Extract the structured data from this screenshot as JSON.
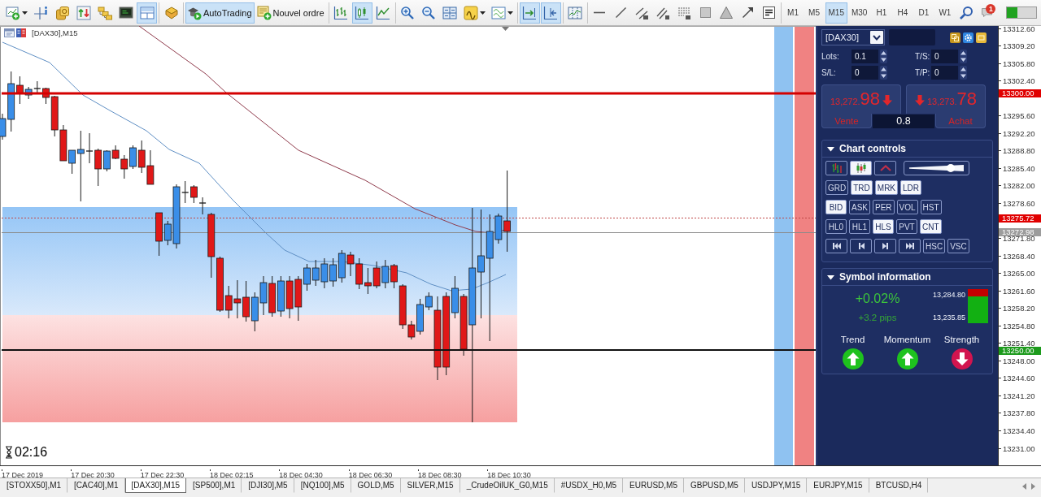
{
  "toolbar": {
    "groups": [
      [
        {
          "kind": "newchart",
          "selected": false,
          "dropdown": true
        },
        {
          "kind": "crosshair",
          "selected": false
        },
        {
          "kind": "market",
          "selected": false
        },
        {
          "kind": "datawindow",
          "selected": false
        },
        {
          "kind": "navigator",
          "selected": false
        },
        {
          "kind": "terminal",
          "selected": false
        },
        {
          "kind": "tester",
          "selected": true
        }
      ],
      [
        {
          "kind": "editor",
          "selected": false
        }
      ],
      [
        {
          "kind": "autotrading",
          "label": "AutoTrading",
          "selected": true
        },
        {
          "kind": "neworder",
          "label": "Nouvel ordre",
          "selected": false
        }
      ],
      [
        {
          "kind": "barchart",
          "selected": false
        },
        {
          "kind": "candles",
          "selected": true
        },
        {
          "kind": "linechart",
          "selected": false
        }
      ],
      [
        {
          "kind": "zoomin",
          "selected": false
        },
        {
          "kind": "zoomout",
          "selected": false
        },
        {
          "kind": "tile",
          "selected": false
        },
        {
          "kind": "indicators",
          "selected": false,
          "dropdown": true
        },
        {
          "kind": "templates",
          "selected": false,
          "dropdown": true
        }
      ],
      [
        {
          "kind": "autoscroll",
          "selected": true
        },
        {
          "kind": "chartshift",
          "selected": true
        }
      ],
      [
        {
          "kind": "periods",
          "selected": false
        }
      ],
      [
        {
          "kind": "hline",
          "selected": false
        },
        {
          "kind": "trendline",
          "selected": false
        },
        {
          "kind": "channel",
          "selected": false
        },
        {
          "kind": "fibo",
          "selected": false
        },
        {
          "kind": "fibogrid",
          "selected": false
        },
        {
          "kind": "rectangle",
          "selected": false
        },
        {
          "kind": "triangle",
          "selected": false
        },
        {
          "kind": "arrow",
          "selected": false
        },
        {
          "kind": "text",
          "selected": false
        }
      ],
      [
        {
          "kind": "period",
          "label": "M1",
          "selected": false
        },
        {
          "kind": "period",
          "label": "M5",
          "selected": false
        },
        {
          "kind": "period",
          "label": "M15",
          "selected": true
        },
        {
          "kind": "period",
          "label": "M30",
          "selected": false
        },
        {
          "kind": "period",
          "label": "H1",
          "selected": false
        },
        {
          "kind": "period",
          "label": "H4",
          "selected": false
        },
        {
          "kind": "period",
          "label": "D1",
          "selected": false
        },
        {
          "kind": "period",
          "label": "W1",
          "selected": false
        },
        {
          "kind": "search",
          "selected": false
        },
        {
          "kind": "alerts",
          "selected": false,
          "badge": "1"
        },
        {
          "kind": "connection"
        }
      ]
    ]
  },
  "chart": {
    "title": "[DAX30],M15",
    "timer": "02:16",
    "price_axis": [
      "13312.60",
      "13309.20",
      "13305.80",
      "13302.40",
      "13295.60",
      "13292.20",
      "13288.80",
      "13285.40",
      "13282.00",
      "13278.60",
      "13271.80",
      "13268.40",
      "13265.00",
      "13261.60",
      "13258.20",
      "13254.80",
      "13251.40",
      "13248.00",
      "13244.60",
      "13241.20",
      "13237.80",
      "13234.40",
      "13231.00"
    ],
    "price_tags": [
      {
        "value": "13300.00",
        "color": "#e00000"
      },
      {
        "value": "13275.72",
        "color": "#e00000"
      },
      {
        "value": "13272.98",
        "color": "#9c9c9c"
      },
      {
        "value": "13250.00",
        "color": "#1c9a1c"
      }
    ],
    "time_axis": [
      "17 Dec 2019",
      "17 Dec 20:30",
      "17 Dec 22:30",
      "18 Dec 02:15",
      "18 Dec 04:30",
      "18 Dec 06:30",
      "18 Dec 08:30",
      "18 Dec 10:30"
    ]
  },
  "panel": {
    "symbol": "[DAX30]",
    "fields": [
      {
        "label": "Lots:",
        "value": "0.1"
      },
      {
        "label": "T/S:",
        "value": "0"
      },
      {
        "label": "S/L:",
        "value": "0"
      },
      {
        "label": "T/P:",
        "value": "0"
      }
    ],
    "sell": {
      "price_main": "13,272.",
      "price_pips": "98",
      "rising": false,
      "label": "Vente"
    },
    "spread": "0.8",
    "buy": {
      "price_main": "13,273.",
      "price_pips": "78",
      "rising": false,
      "label": "Achat"
    },
    "chart_controls": {
      "title": "Chart controls",
      "expanded": true,
      "chart_types": [
        {
          "kind": "bars",
          "selected": false
        },
        {
          "kind": "candles",
          "selected": true
        },
        {
          "kind": "line",
          "selected": false
        }
      ],
      "zoom": {
        "level": 0.76
      },
      "rows": [
        [
          {
            "kind": "label",
            "label": "GRD",
            "selected": false
          },
          {
            "kind": "label",
            "label": "TRD",
            "selected": true
          },
          {
            "kind": "label",
            "label": "MRK",
            "selected": true
          },
          {
            "kind": "label",
            "label": "LDR",
            "selected": true
          }
        ],
        [
          {
            "kind": "label",
            "label": "BID",
            "selected": true
          },
          {
            "kind": "label",
            "label": "ASK",
            "selected": false
          },
          {
            "kind": "label",
            "label": "PER",
            "selected": false
          },
          {
            "kind": "label",
            "label": "VOL",
            "selected": false
          },
          {
            "kind": "label",
            "label": "HST",
            "selected": false
          }
        ],
        [
          {
            "kind": "label",
            "label": "HL0",
            "selected": false
          },
          {
            "kind": "label",
            "label": "HL1",
            "selected": false
          },
          {
            "kind": "label",
            "label": "HLS",
            "selected": true
          },
          {
            "kind": "label",
            "label": "PVT",
            "selected": false
          },
          {
            "kind": "label",
            "label": "CNT",
            "selected": true
          }
        ],
        [
          {
            "kind": "first",
            "selected": false
          },
          {
            "kind": "prev",
            "selected": false
          },
          {
            "kind": "next",
            "selected": false
          },
          {
            "kind": "last",
            "selected": false
          },
          {
            "kind": "label",
            "label": "HSC",
            "selected": false
          },
          {
            "kind": "label",
            "label": "VSC",
            "selected": false
          }
        ]
      ]
    },
    "symbol_information": {
      "title": "Symbol information",
      "expanded": true,
      "change_percent": "+0.02%",
      "change_pips": "+3.2 pips",
      "range": {
        "high": "13,284.80",
        "low": "13,235.85",
        "level": 0.78
      },
      "indicators": [
        {
          "label": "Trend",
          "rising": true
        },
        {
          "label": "Momentum",
          "rising": true
        },
        {
          "label": "Strength",
          "rising": false
        }
      ]
    }
  },
  "tabs": [
    {
      "label": "[STOXX50],M1",
      "selected": false
    },
    {
      "label": "[CAC40],M1",
      "selected": false
    },
    {
      "label": "[DAX30],M15",
      "selected": true
    },
    {
      "label": "[SP500],M1",
      "selected": false
    },
    {
      "label": "[DJI30],M5",
      "selected": false
    },
    {
      "label": "[NQ100],M5",
      "selected": false
    },
    {
      "label": "GOLD,M5",
      "selected": false
    },
    {
      "label": "SILVER,M15",
      "selected": false
    },
    {
      "label": "_CrudeOilUK_G0,M15",
      "selected": false
    },
    {
      "label": "#USDX_H0,M5",
      "selected": false
    },
    {
      "label": "EURUSD,M5",
      "selected": false
    },
    {
      "label": "GBPUSD,M5",
      "selected": false
    },
    {
      "label": "USDJPY,M15",
      "selected": false
    },
    {
      "label": "EURJPY,M15",
      "selected": false
    },
    {
      "label": "BTCUSD,H4",
      "selected": false
    }
  ]
}
